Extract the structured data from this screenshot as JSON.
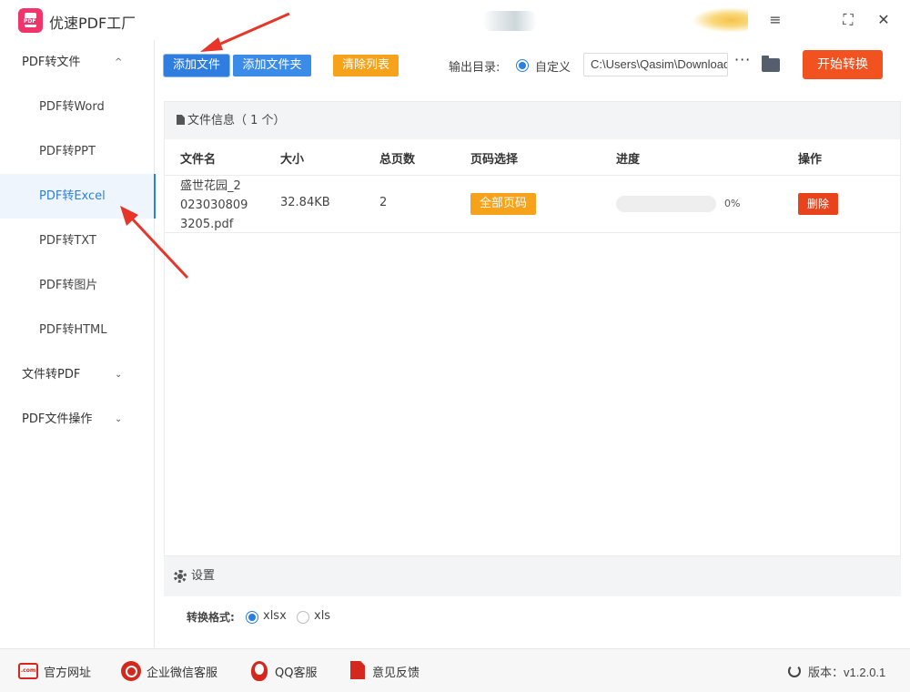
{
  "app": {
    "title": "优速PDF工厂",
    "logo_text": "PDF"
  },
  "window_controls": {
    "menu": "≡",
    "maximize": "⛶",
    "close": "✕"
  },
  "sidebar": {
    "groups": [
      {
        "label": "PDF转文件",
        "chevron": "^",
        "expanded": true
      },
      {
        "label": "文件转PDF",
        "chevron": "⌄",
        "expanded": false
      },
      {
        "label": "PDF文件操作",
        "chevron": "⌄",
        "expanded": false
      }
    ],
    "items": [
      {
        "label": "PDF转Word",
        "active": false
      },
      {
        "label": "PDF转PPT",
        "active": false
      },
      {
        "label": "PDF转Excel",
        "active": true
      },
      {
        "label": "PDF转TXT",
        "active": false
      },
      {
        "label": "PDF转图片",
        "active": false
      },
      {
        "label": "PDF转HTML",
        "active": false
      }
    ]
  },
  "toolbar": {
    "add_file": "添加文件",
    "add_folder": "添加文件夹",
    "clear_list": "清除列表",
    "output_dir_label": "输出目录:",
    "custom_option": "自定义",
    "output_path": "C:\\Users\\Qasim\\Downloads",
    "more": "···",
    "start": "开始转换"
  },
  "file_panel": {
    "title": "文件信息",
    "count_text": "（ 1 个）",
    "columns": [
      "文件名",
      "大小",
      "总页数",
      "页码选择",
      "进度",
      "操作"
    ],
    "rows": [
      {
        "name_lines": [
          "盛世花园_2",
          "023030809",
          "3205.pdf"
        ],
        "size": "32.84KB",
        "pages": "2",
        "page_select": "全部页码",
        "progress": 0,
        "progress_text": "0%",
        "action": "删除"
      }
    ]
  },
  "settings": {
    "title": "设置",
    "format_label": "转换格式:",
    "formats": [
      {
        "label": "xlsx",
        "selected": true
      },
      {
        "label": "xls",
        "selected": false
      }
    ]
  },
  "footer": {
    "links": [
      "官方网址",
      "企业微信客服",
      "QQ客服",
      "意见反馈"
    ],
    "com_icon_text": ".com",
    "version_label": "版本：",
    "version": "v1.2.0.1"
  },
  "colors": {
    "accent_blue": "#2b7fe0",
    "button_blue": "#3b8be9",
    "orange": "#f6a21b",
    "red": "#f1521f",
    "footer_red": "#d4281e",
    "annotation_arrow": "#e8352a"
  }
}
